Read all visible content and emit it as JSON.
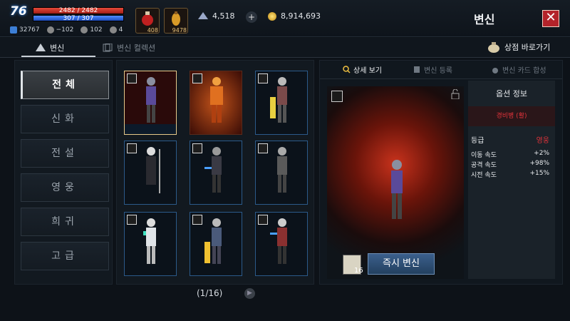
{
  "player": {
    "level": "76",
    "hp": "2482 / 2482",
    "mp": "307 / 307",
    "stats": [
      {
        "icon": "shield-blue-icon",
        "value": "32767"
      },
      {
        "icon": "helmet-icon",
        "value": "−102"
      },
      {
        "icon": "boot-icon",
        "value": "102"
      },
      {
        "icon": "sword-icon",
        "value": "4"
      }
    ]
  },
  "consumables": [
    {
      "icon": "red-potion-icon",
      "count": "408"
    },
    {
      "icon": "yellow-potion-icon",
      "count": "9478"
    }
  ],
  "currency": {
    "crystal": {
      "icon": "crystal-icon",
      "value": "4,518"
    },
    "gold": {
      "icon": "gold-coin-icon",
      "value": "8,914,693"
    }
  },
  "window": {
    "title": "변신",
    "close_glyph": "✕"
  },
  "tabs": {
    "polymorph": "변신",
    "collection": "변신 컬렉션",
    "shop": "상점 바로가기"
  },
  "categories": [
    "전체",
    "신화",
    "전설",
    "영웅",
    "희귀",
    "고급"
  ],
  "active_category": "전체",
  "cards": [
    {
      "style": "selected",
      "badge": "bow-icon"
    },
    {
      "style": "fire",
      "badge": "sword-icon"
    },
    {
      "style": "normal",
      "badge": "sword-icon"
    },
    {
      "style": "normal",
      "badge": "staff-icon"
    },
    {
      "style": "normal",
      "badge": "sword-icon"
    },
    {
      "style": "normal",
      "badge": "bow-icon"
    },
    {
      "style": "normal",
      "badge": "bow-icon"
    },
    {
      "style": "normal",
      "badge": "sword-icon"
    },
    {
      "style": "normal",
      "badge": "sword-icon"
    }
  ],
  "pager": {
    "text": "(1/16)",
    "next_glyph": "▶"
  },
  "detail": {
    "tabs": [
      "상세 보기",
      "변신 등록",
      "변신 카드 합성"
    ],
    "instant_button": "즉시 변신",
    "scroll_count": "16"
  },
  "options": {
    "title": "옵션 정보",
    "name": "경비병 (활)",
    "grade_label": "등급",
    "grade_value": "영웅",
    "rows": [
      {
        "label": "이동 속도",
        "value": "+2%"
      },
      {
        "label": "공격 속도",
        "value": "+98%"
      },
      {
        "label": "시전 속도",
        "value": "+15%"
      }
    ]
  },
  "colors": {
    "accent_red": "#e0333a",
    "button_blue": "#3b5f8c",
    "selected_border": "#e6c98a",
    "card_border": "#2b5a8a"
  }
}
